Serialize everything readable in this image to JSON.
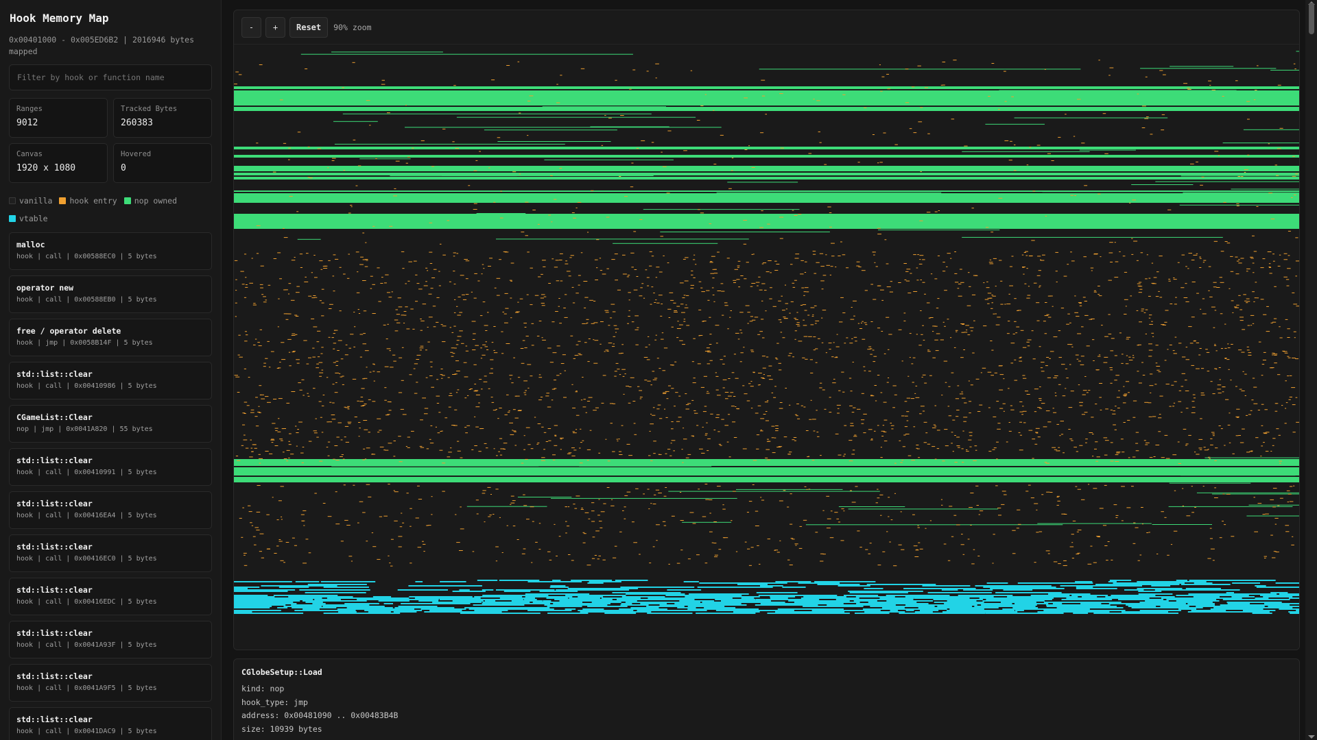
{
  "sidebar": {
    "title": "Hook Memory Map",
    "range_summary": "0x00401000 - 0x005ED6B2 | 2016946 bytes mapped",
    "filter_placeholder": "Filter by hook or function name",
    "stats": {
      "ranges_label": "Ranges",
      "ranges_value": "9012",
      "tracked_label": "Tracked Bytes",
      "tracked_value": "260383",
      "canvas_label": "Canvas",
      "canvas_value": "1920 x 1080",
      "hovered_label": "Hovered",
      "hovered_value": "0"
    },
    "legend": [
      {
        "label": "vanilla",
        "color": "#1f1f1f"
      },
      {
        "label": "hook entry",
        "color": "#f0a030"
      },
      {
        "label": "nop owned",
        "color": "#3ddc78"
      },
      {
        "label": "vtable",
        "color": "#22d3e6"
      }
    ],
    "hooks": [
      {
        "name": "malloc",
        "meta": "hook | call | 0x00588EC0 | 5 bytes"
      },
      {
        "name": "operator new",
        "meta": "hook | call | 0x00588EB0 | 5 bytes"
      },
      {
        "name": "free / operator delete",
        "meta": "hook | jmp | 0x0058B14F | 5 bytes"
      },
      {
        "name": "std::list::clear",
        "meta": "hook | call | 0x00410986 | 5 bytes"
      },
      {
        "name": "CGameList::Clear",
        "meta": "nop | jmp | 0x0041A820 | 55 bytes"
      },
      {
        "name": "std::list::clear",
        "meta": "hook | call | 0x00410991 | 5 bytes"
      },
      {
        "name": "std::list::clear",
        "meta": "hook | call | 0x00416EA4 | 5 bytes"
      },
      {
        "name": "std::list::clear",
        "meta": "hook | call | 0x00416EC0 | 5 bytes"
      },
      {
        "name": "std::list::clear",
        "meta": "hook | call | 0x00416EDC | 5 bytes"
      },
      {
        "name": "std::list::clear",
        "meta": "hook | call | 0x0041A93F | 5 bytes"
      },
      {
        "name": "std::list::clear",
        "meta": "hook | call | 0x0041A9F5 | 5 bytes"
      },
      {
        "name": "std::list::clear",
        "meta": "hook | call | 0x0041DAC9 | 5 bytes"
      }
    ]
  },
  "toolbar": {
    "zoom_out_label": "-",
    "zoom_in_label": "+",
    "reset_label": "Reset",
    "zoom_text": "90% zoom"
  },
  "map_colors": {
    "background": "#1a1a1a",
    "hook_entry": "#f0a030",
    "nop_owned": "#3ddc78",
    "vtable": "#22d3e6"
  },
  "detail": {
    "title": "CGlobeSetup::Load",
    "lines": [
      "kind: nop",
      "hook_type: jmp",
      "address: 0x00481090 .. 0x00483B4B",
      "size: 10939 bytes"
    ]
  }
}
